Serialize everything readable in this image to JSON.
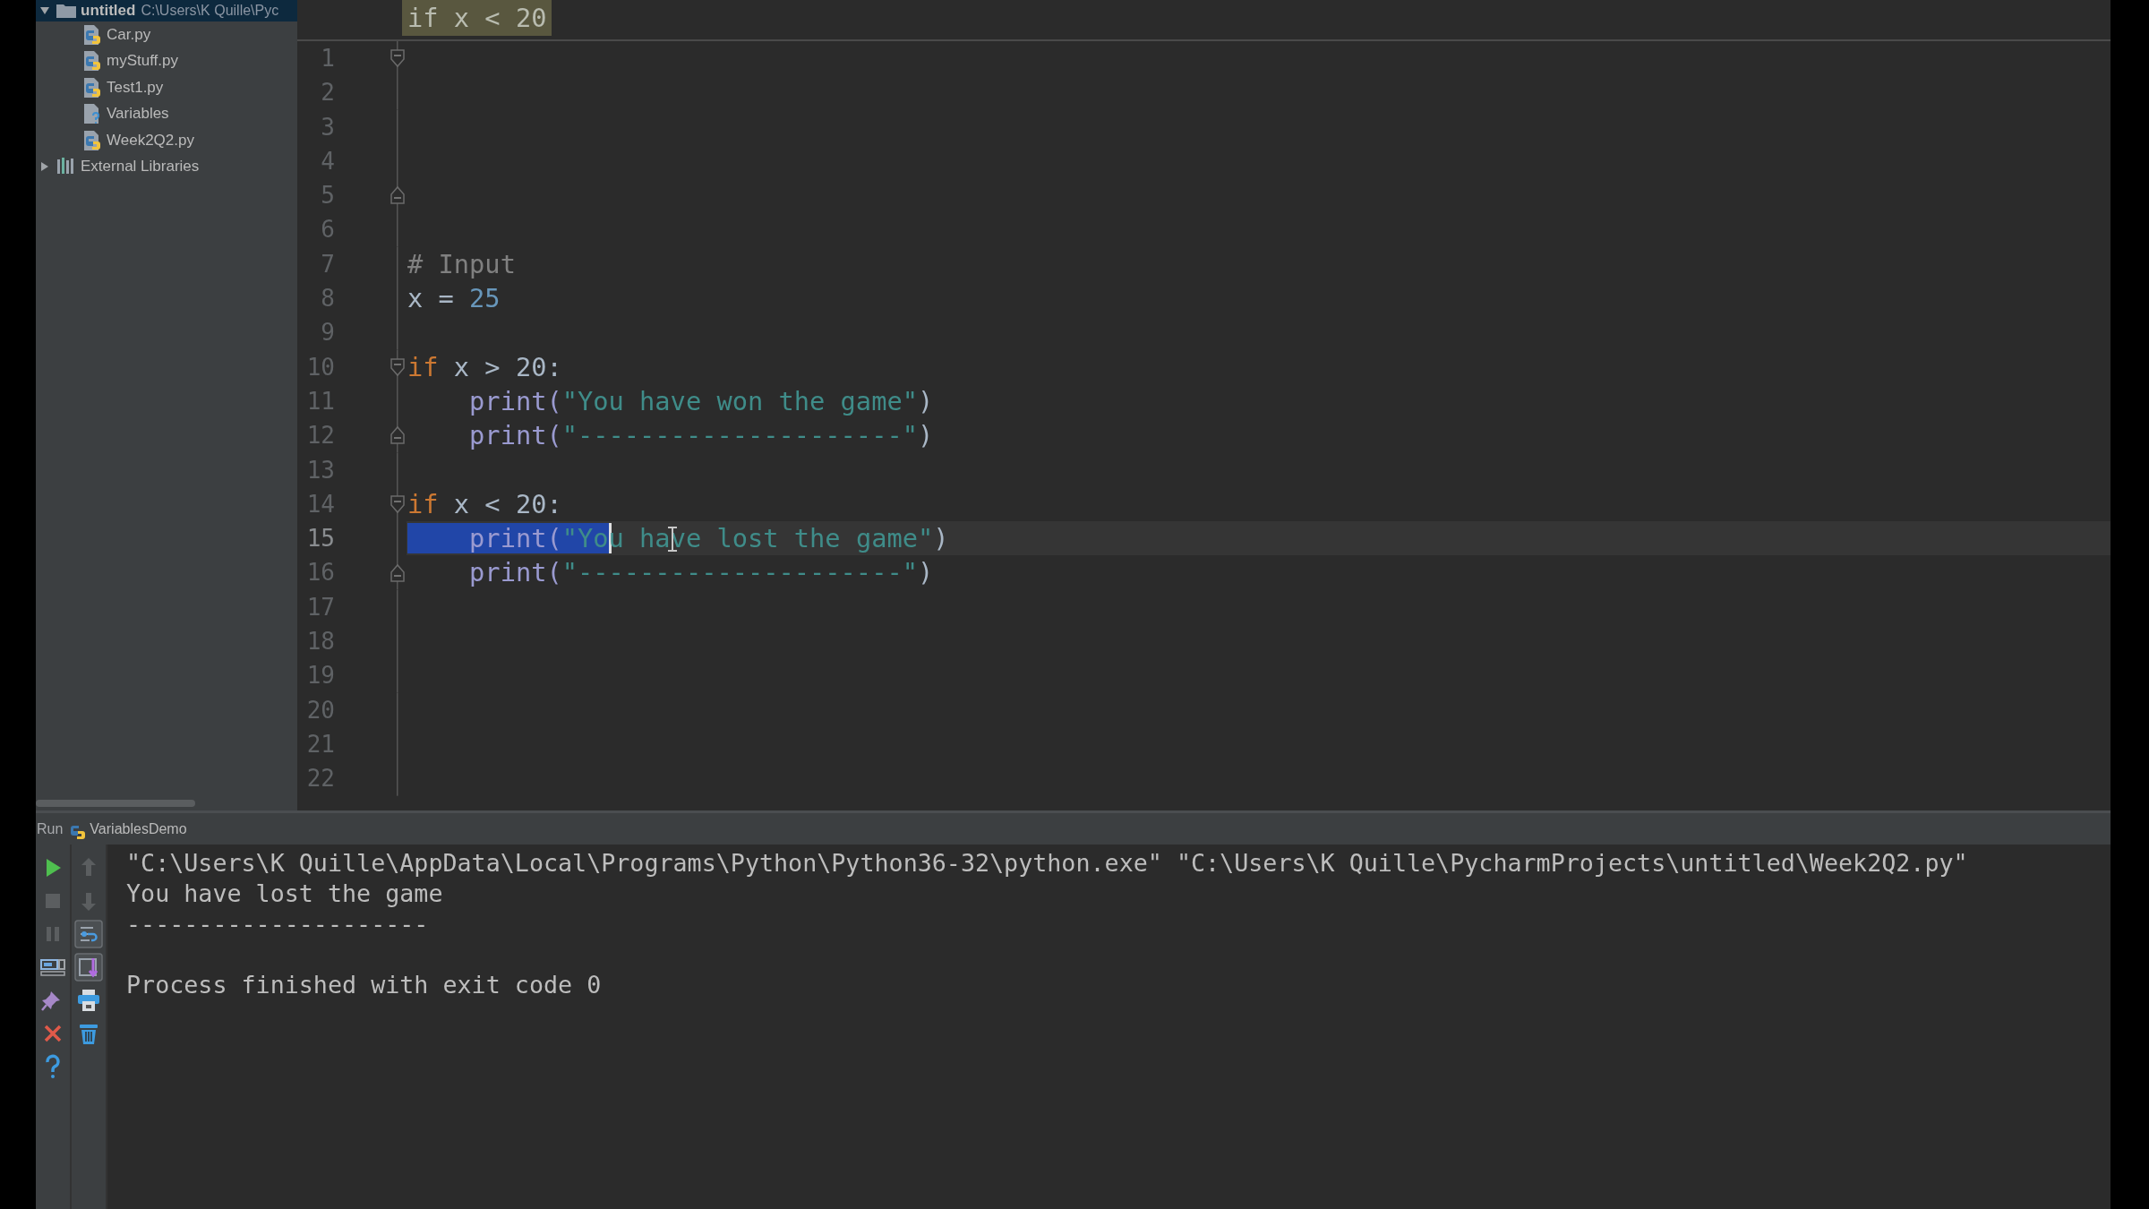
{
  "project_tree": {
    "items": [
      {
        "name": "untitled",
        "path": "C:\\Users\\K Quille\\Pyc",
        "kind": "folder",
        "expanded": true,
        "selected": true,
        "children": [
          {
            "name": "Car.py",
            "kind": "python",
            "selected": false
          },
          {
            "name": "myStuff.py",
            "kind": "python",
            "selected": false
          },
          {
            "name": "Test1.py",
            "kind": "python",
            "selected": false
          },
          {
            "name": "Variables",
            "kind": "unknown",
            "selected": false
          },
          {
            "name": "Week2Q2.py",
            "kind": "python",
            "selected": false
          }
        ]
      },
      {
        "name": "External Libraries",
        "kind": "library",
        "expanded": false,
        "selected": false
      }
    ]
  },
  "editor": {
    "sticky_header": "if x < 20",
    "lines": [
      {
        "number": "1",
        "kind": "fold-start",
        "current": false
      },
      {
        "number": "2",
        "kind": "plain",
        "current": false
      },
      {
        "number": "3",
        "kind": "plain",
        "current": false
      },
      {
        "number": "4",
        "kind": "plain",
        "current": false
      },
      {
        "number": "5",
        "kind": "fold-end",
        "current": false
      },
      {
        "number": "6",
        "kind": "plain",
        "current": false
      },
      {
        "number": "7",
        "kind": "plain",
        "current": false,
        "tokens": [
          {
            "text": "# Input",
            "kind": "comment",
            "selected": false
          }
        ]
      },
      {
        "number": "8",
        "kind": "plain",
        "current": false,
        "tokens": [
          {
            "text": "x = ",
            "kind": "plain",
            "selected": false
          },
          {
            "text": "25",
            "kind": "number",
            "selected": false
          }
        ]
      },
      {
        "number": "9",
        "kind": "plain",
        "current": false
      },
      {
        "number": "10",
        "kind": "fold-start",
        "current": false,
        "tokens": [
          {
            "text": "if",
            "kind": "keyword",
            "selected": false
          },
          {
            "text": " x > 20:",
            "kind": "plain",
            "selected": false
          }
        ]
      },
      {
        "number": "11",
        "kind": "plain",
        "current": false,
        "tokens": [
          {
            "text": "    print(",
            "kind": "builtin",
            "selected": false
          },
          {
            "text": "\"You have won the game\"",
            "kind": "string",
            "selected": false
          },
          {
            "text": ")",
            "kind": "plain",
            "selected": false
          }
        ]
      },
      {
        "number": "12",
        "kind": "fold-end",
        "current": false,
        "tokens": [
          {
            "text": "    print(",
            "kind": "builtin",
            "selected": false
          },
          {
            "text": "\"---------------------\"",
            "kind": "string",
            "selected": false
          },
          {
            "text": ")",
            "kind": "plain",
            "selected": false
          }
        ]
      },
      {
        "number": "13",
        "kind": "plain",
        "current": false
      },
      {
        "number": "14",
        "kind": "fold-start",
        "current": false,
        "tokens": [
          {
            "text": "if",
            "kind": "keyword",
            "selected": false
          },
          {
            "text": " x < 20:",
            "kind": "plain",
            "selected": false
          }
        ]
      },
      {
        "number": "15",
        "kind": "plain",
        "current": true,
        "tokens": [
          {
            "text": "    print(",
            "kind": "builtin",
            "selected": true
          },
          {
            "text": "\"Yo",
            "kind": "string",
            "selected": true
          },
          {
            "text": "u have lost the game\"",
            "kind": "string",
            "selected": false
          },
          {
            "text": ")",
            "kind": "plain",
            "selected": false
          }
        ]
      },
      {
        "number": "16",
        "kind": "fold-end",
        "current": false,
        "tokens": [
          {
            "text": "    print(",
            "kind": "builtin",
            "selected": false
          },
          {
            "text": "\"---------------------\"",
            "kind": "string",
            "selected": false
          },
          {
            "text": ")",
            "kind": "plain",
            "selected": false
          }
        ]
      },
      {
        "number": "17",
        "kind": "plain",
        "current": false
      },
      {
        "number": "18",
        "kind": "plain",
        "current": false
      },
      {
        "number": "19",
        "kind": "plain",
        "current": false
      },
      {
        "number": "20",
        "kind": "plain",
        "current": false
      },
      {
        "number": "21",
        "kind": "plain",
        "current": false
      },
      {
        "number": "22",
        "kind": "plain",
        "current": false
      }
    ]
  },
  "run_panel": {
    "label": "Run",
    "config": "VariablesDemo",
    "toolbar": [
      [
        {
          "kind": "run",
          "disabled": false
        },
        {
          "kind": "stop",
          "disabled": true
        },
        {
          "kind": "pause",
          "disabled": true
        },
        {
          "kind": "layout",
          "disabled": false
        },
        {
          "kind": "pin",
          "disabled": false
        },
        {
          "kind": "close",
          "disabled": false
        },
        {
          "kind": "help",
          "disabled": false
        }
      ],
      [
        {
          "kind": "up",
          "disabled": true
        },
        {
          "kind": "down",
          "disabled": true
        },
        {
          "kind": "soft-wrap",
          "disabled": false,
          "on": true
        },
        {
          "kind": "scroll-end",
          "disabled": false,
          "on": true
        },
        {
          "kind": "print",
          "disabled": false
        },
        {
          "kind": "trash",
          "disabled": false
        }
      ]
    ],
    "console": {
      "lines": [
        "\"C:\\Users\\K Quille\\AppData\\Local\\Programs\\Python\\Python36-32\\python.exe\" \"C:\\Users\\K Quille\\PycharmProjects\\untitled\\Week2Q2.py\"",
        "You have lost the game",
        "---------------------"
      ],
      "exit_message": "Process finished with exit code 0"
    }
  }
}
